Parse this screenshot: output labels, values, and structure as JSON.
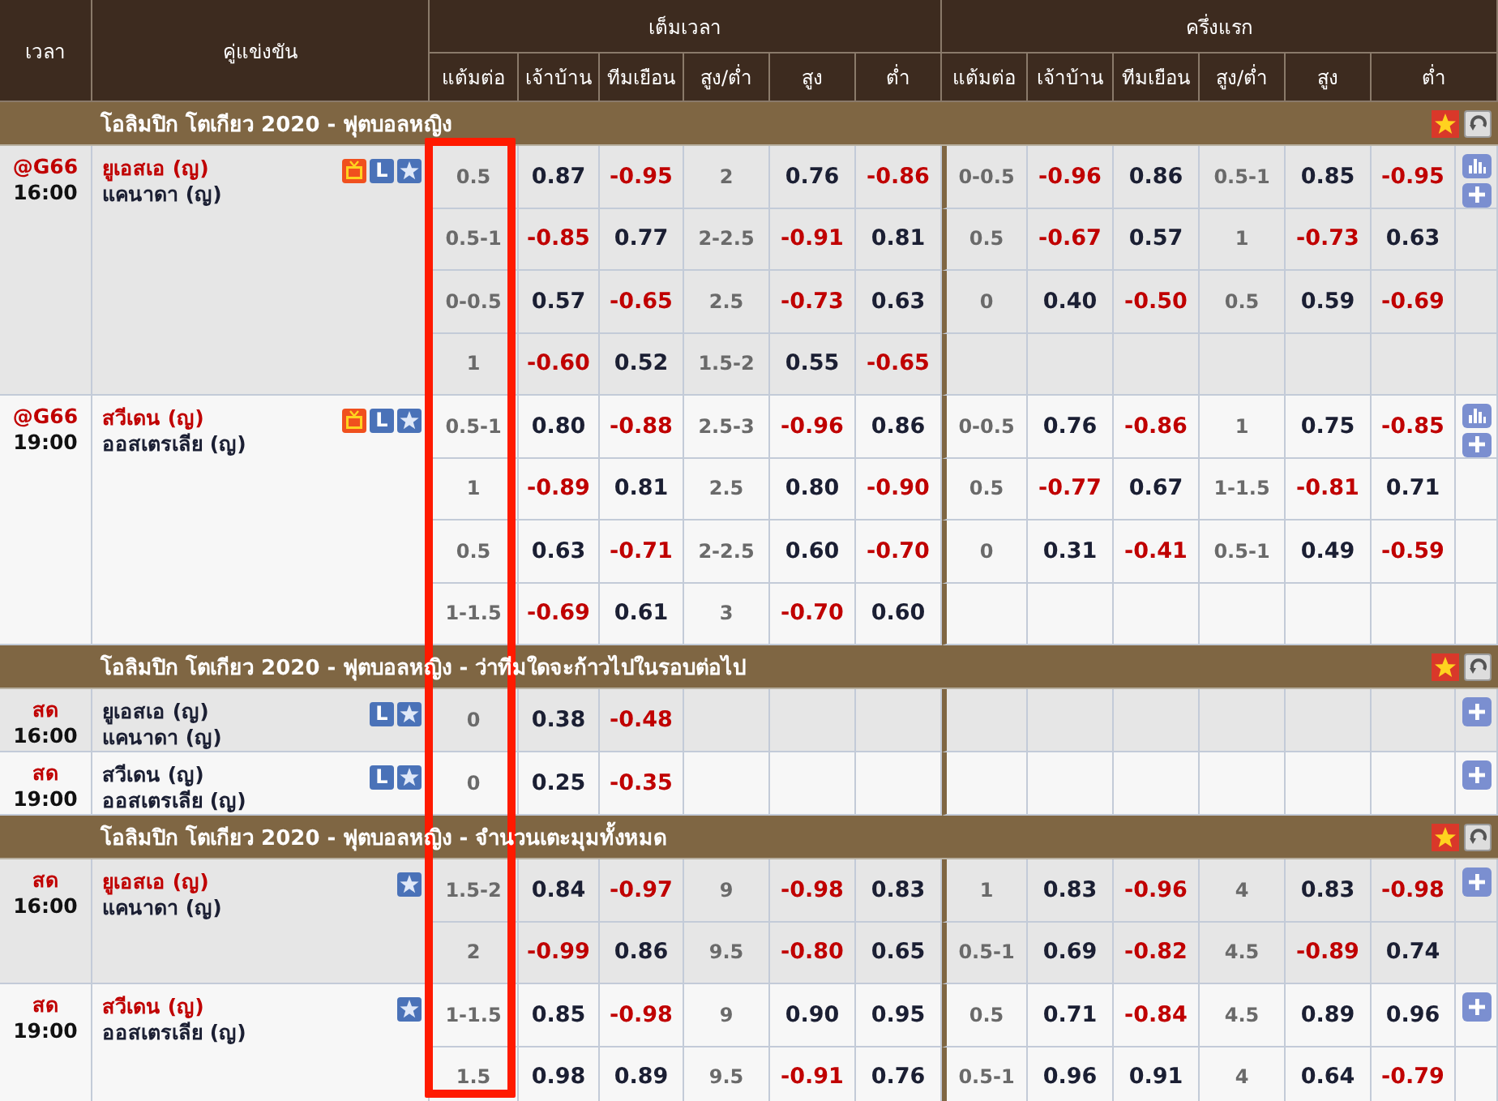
{
  "header": {
    "time": "เวลา",
    "match": "คู่แข่งขัน",
    "full_time": "เต็มเวลา",
    "first_half": "ครึ่งแรก",
    "full_columns": [
      "แต้มต่อ",
      "เจ้าบ้าน",
      "ทีมเยือน",
      "สูง/ต่ำ",
      "สูง",
      "ต่ำ"
    ],
    "half_columns": [
      "แต้มต่อ",
      "เจ้าบ้าน",
      "ทีมเยือน",
      "สูง/ต่ำ",
      "สูง",
      "ต่ำ"
    ]
  },
  "sections": [
    {
      "title": "โอลิมปิก โตเกียว 2020 - ฟุตบอลหญิง",
      "matches": [
        {
          "status": "@G66",
          "time": "16:00",
          "home": "ยูเอสเอ (ญ)",
          "away": "แคนาดา (ญ)",
          "home_highlighted": true,
          "icons": [
            {
              "kind": "tv"
            },
            {
              "kind": "badge",
              "label": "L"
            },
            {
              "kind": "star"
            }
          ],
          "actions": [
            {
              "kind": "stats"
            },
            {
              "kind": "add"
            }
          ],
          "lines": [
            {
              "full": [
                "0.5",
                "0.87",
                "-0.95",
                "2",
                "0.76",
                "-0.86"
              ],
              "half": [
                "0-0.5",
                "-0.96",
                "0.86",
                "0.5-1",
                "0.85",
                "-0.95"
              ]
            },
            {
              "full": [
                "0.5-1",
                "-0.85",
                "0.77",
                "2-2.5",
                "-0.91",
                "0.81"
              ],
              "half": [
                "0.5",
                "-0.67",
                "0.57",
                "1",
                "-0.73",
                "0.63"
              ]
            },
            {
              "full": [
                "0-0.5",
                "0.57",
                "-0.65",
                "2.5",
                "-0.73",
                "0.63"
              ],
              "half": [
                "0",
                "0.40",
                "-0.50",
                "0.5",
                "0.59",
                "-0.69"
              ]
            },
            {
              "full": [
                "1",
                "-0.60",
                "0.52",
                "1.5-2",
                "0.55",
                "-0.65"
              ]
            }
          ]
        },
        {
          "status": "@G66",
          "time": "19:00",
          "home": "สวีเดน (ญ)",
          "away": "ออสเตรเลีย (ญ)",
          "home_highlighted": true,
          "icons": [
            {
              "kind": "tv"
            },
            {
              "kind": "badge",
              "label": "L"
            },
            {
              "kind": "star"
            }
          ],
          "actions": [
            {
              "kind": "stats"
            },
            {
              "kind": "add"
            }
          ],
          "lines": [
            {
              "full": [
                "0.5-1",
                "0.80",
                "-0.88",
                "2.5-3",
                "-0.96",
                "0.86"
              ],
              "half": [
                "0-0.5",
                "0.76",
                "-0.86",
                "1",
                "0.75",
                "-0.85"
              ]
            },
            {
              "full": [
                "1",
                "-0.89",
                "0.81",
                "2.5",
                "0.80",
                "-0.90"
              ],
              "half": [
                "0.5",
                "-0.77",
                "0.67",
                "1-1.5",
                "-0.81",
                "0.71"
              ]
            },
            {
              "full": [
                "0.5",
                "0.63",
                "-0.71",
                "2-2.5",
                "0.60",
                "-0.70"
              ],
              "half": [
                "0",
                "0.31",
                "-0.41",
                "0.5-1",
                "0.49",
                "-0.59"
              ]
            },
            {
              "full": [
                "1-1.5",
                "-0.69",
                "0.61",
                "3",
                "-0.70",
                "0.60"
              ]
            }
          ]
        }
      ]
    },
    {
      "title": "โอลิมปิก โตเกียว 2020 - ฟุตบอลหญิง - ว่าทีมใดจะก้าวไปในรอบต่อไป",
      "matches": [
        {
          "status": "สด",
          "time": "16:00",
          "home": "ยูเอสเอ (ญ)",
          "away": "แคนาดา (ญ)",
          "home_highlighted": false,
          "icons": [
            {
              "kind": "badge",
              "label": "L"
            },
            {
              "kind": "star"
            }
          ],
          "actions": [
            {
              "kind": "add"
            }
          ],
          "lines": [
            {
              "full": [
                "0",
                "0.38",
                "-0.48"
              ]
            }
          ]
        },
        {
          "status": "สด",
          "time": "19:00",
          "home": "สวีเดน (ญ)",
          "away": "ออสเตรเลีย (ญ)",
          "home_highlighted": false,
          "icons": [
            {
              "kind": "badge",
              "label": "L"
            },
            {
              "kind": "star"
            }
          ],
          "actions": [
            {
              "kind": "add"
            }
          ],
          "lines": [
            {
              "full": [
                "0",
                "0.25",
                "-0.35"
              ]
            }
          ]
        }
      ]
    },
    {
      "title": "โอลิมปิก โตเกียว 2020 - ฟุตบอลหญิง - จำนวนเตะมุมทั้งหมด",
      "matches": [
        {
          "status": "สด",
          "time": "16:00",
          "home": "ยูเอสเอ (ญ)",
          "away": "แคนาดา (ญ)",
          "home_highlighted": true,
          "icons": [
            {
              "kind": "star"
            }
          ],
          "actions": [
            {
              "kind": "add"
            }
          ],
          "lines": [
            {
              "full": [
                "1.5-2",
                "0.84",
                "-0.97",
                "9",
                "-0.98",
                "0.83"
              ],
              "half": [
                "1",
                "0.83",
                "-0.96",
                "4",
                "0.83",
                "-0.98"
              ]
            },
            {
              "full": [
                "2",
                "-0.99",
                "0.86",
                "9.5",
                "-0.80",
                "0.65"
              ],
              "half": [
                "0.5-1",
                "0.69",
                "-0.82",
                "4.5",
                "-0.89",
                "0.74"
              ]
            }
          ]
        },
        {
          "status": "สด",
          "time": "19:00",
          "home": "สวีเดน (ญ)",
          "away": "ออสเตรเลีย (ญ)",
          "home_highlighted": true,
          "icons": [
            {
              "kind": "star"
            }
          ],
          "actions": [
            {
              "kind": "add"
            }
          ],
          "lines": [
            {
              "full": [
                "1-1.5",
                "0.85",
                "-0.98",
                "9",
                "0.90",
                "0.95"
              ],
              "half": [
                "0.5",
                "0.71",
                "-0.84",
                "4.5",
                "0.89",
                "0.96"
              ]
            },
            {
              "full": [
                "1.5",
                "0.98",
                "0.89",
                "9.5",
                "-0.91",
                "0.76"
              ],
              "half": [
                "0.5-1",
                "0.96",
                "0.91",
                "4",
                "0.64",
                "-0.79"
              ]
            }
          ]
        }
      ]
    }
  ],
  "highlight_frame": {
    "shown": true
  }
}
